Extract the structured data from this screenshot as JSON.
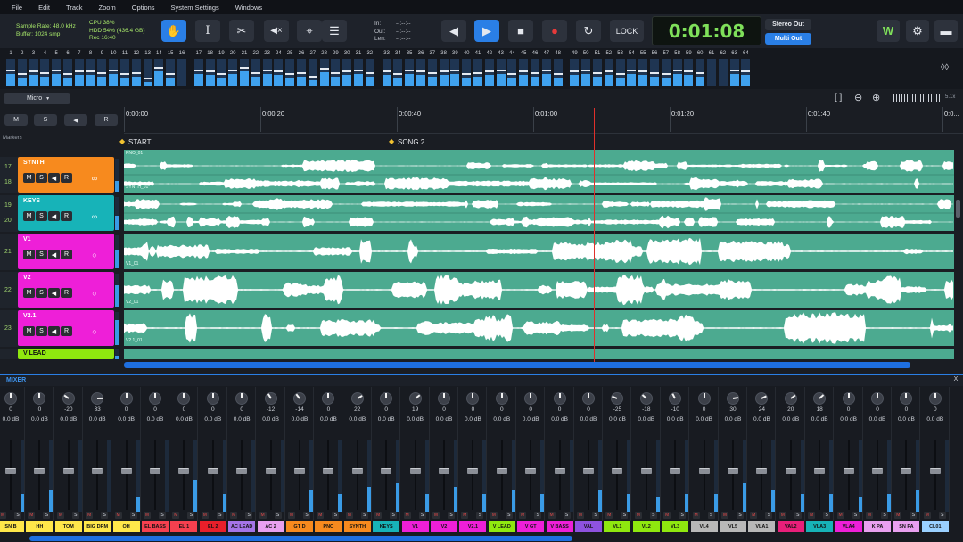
{
  "menu": [
    "File",
    "Edit",
    "Track",
    "Zoom",
    "Options",
    "System Settings",
    "Windows"
  ],
  "status": {
    "sample_rate": "Sample Rate: 48.0 kHz",
    "buffer": "Buffer: 1024 smp",
    "cpu": "CPU 38%",
    "hdd": "HDD 54% (436.4 GB)",
    "rec": "Rec 16:40",
    "in_label": "In:",
    "in_value": "--:--:--",
    "out_label": "Out:",
    "out_value": "--:--:--",
    "len_label": "Len:",
    "len_value": "--:--:--"
  },
  "transport": {
    "lock": "LOCK",
    "time": "0:01:08"
  },
  "outputs": {
    "stereo": "Stereo Out",
    "multi": "Multi Out"
  },
  "meter_channels": [
    "1",
    "2",
    "3",
    "4",
    "5",
    "6",
    "7",
    "8",
    "9",
    "10",
    "11",
    "12",
    "13",
    "14",
    "15",
    "16",
    "17",
    "18",
    "19",
    "20",
    "21",
    "22",
    "23",
    "24",
    "25",
    "26",
    "27",
    "28",
    "29",
    "30",
    "31",
    "32",
    "33",
    "34",
    "35",
    "36",
    "37",
    "38",
    "39",
    "40",
    "41",
    "42",
    "43",
    "44",
    "45",
    "46",
    "47",
    "48",
    "49",
    "50",
    "51",
    "52",
    "53",
    "54",
    "55",
    "56",
    "57",
    "58",
    "59",
    "60",
    "61",
    "62",
    "63",
    "64"
  ],
  "meter_levels": [
    0.45,
    0.3,
    0.4,
    0.35,
    0.45,
    0.3,
    0.4,
    0.4,
    0.35,
    0.45,
    0.3,
    0.35,
    0.15,
    0.55,
    0.3,
    0.0,
    0.45,
    0.4,
    0.3,
    0.45,
    0.55,
    0.35,
    0.45,
    0.4,
    0.3,
    0.35,
    0.2,
    0.5,
    0.35,
    0.4,
    0.45,
    0.35,
    0.4,
    0.3,
    0.45,
    0.4,
    0.35,
    0.4,
    0.45,
    0.3,
    0.35,
    0.4,
    0.45,
    0.3,
    0.4,
    0.35,
    0.45,
    0.3,
    0.4,
    0.45,
    0.35,
    0.4,
    0.3,
    0.45,
    0.4,
    0.35,
    0.3,
    0.45,
    0.4,
    0.35,
    0.0,
    0.0,
    0.45,
    0.4
  ],
  "arrange": {
    "input_select": "Micro",
    "mute_btn": "M",
    "solo_btn": "S",
    "speaker_btn": "◀",
    "rec_btn": "R",
    "zoom_label": "5.1x",
    "markers_label": "Markers",
    "markers": [
      "START",
      "SONG 2"
    ],
    "ruler": [
      "0:00:00",
      "0:00:20",
      "0:00:40",
      "0:01:00",
      "0:01:20",
      "0:01:40",
      "0:0..."
    ]
  },
  "tracks": [
    {
      "nums": [
        "17",
        "18"
      ],
      "name": "SYNTH",
      "color": "#f78a1e",
      "clip": "SYNTH_01",
      "top_clip": "PNO_01",
      "ring": "∞"
    },
    {
      "nums": [
        "19",
        "20"
      ],
      "name": "KEYS",
      "color": "#17b3b8",
      "clip": "",
      "top_clip": "",
      "ring": "∞"
    },
    {
      "nums": [
        "21"
      ],
      "name": "V1",
      "color": "#ee1fd8",
      "clip": "V1_01",
      "top_clip": "",
      "ring": "○"
    },
    {
      "nums": [
        "22"
      ],
      "name": "V2",
      "color": "#ee1fd8",
      "clip": "V2_01",
      "top_clip": "",
      "ring": "○"
    },
    {
      "nums": [
        "23"
      ],
      "name": "V2.1",
      "color": "#ee1fd8",
      "clip": "V2.1_01",
      "top_clip": "",
      "ring": "○"
    },
    {
      "nums": [
        ""
      ],
      "name": "V LEAD",
      "color": "#8fe80f",
      "clip": "",
      "top_clip": "",
      "ring": ""
    }
  ],
  "track_buttons": [
    "M",
    "S",
    "◀",
    "R"
  ],
  "mixer": {
    "title": "MIXER",
    "close": "X",
    "channels": [
      {
        "name": "SN B",
        "color": "#ffe74a",
        "pan": "0",
        "db": "0.0 dB",
        "fader": 0.55,
        "level": 0.25
      },
      {
        "name": "HH",
        "color": "#ffe74a",
        "pan": "0",
        "db": "0.0 dB",
        "fader": 0.55,
        "level": 0.3
      },
      {
        "name": "TOM",
        "color": "#ffe74a",
        "pan": "-20",
        "db": "0.0 dB",
        "fader": 0.55,
        "level": 0.0
      },
      {
        "name": "BIG DRM",
        "color": "#ffe74a",
        "pan": "33",
        "db": "0.0 dB",
        "fader": 0.55,
        "level": 0.0
      },
      {
        "name": "OH",
        "color": "#ffe74a",
        "pan": "0",
        "db": "0.0 dB",
        "fader": 0.55,
        "level": 0.2
      },
      {
        "name": "EL BASS",
        "color": "#f5404f",
        "pan": "0",
        "db": "0.0 dB",
        "fader": 0.55,
        "level": 0.0
      },
      {
        "name": "EL 1",
        "color": "#f5404f",
        "pan": "0",
        "db": "0.0 dB",
        "fader": 0.55,
        "level": 0.45
      },
      {
        "name": "EL 2",
        "color": "#e81f2a",
        "pan": "0",
        "db": "0.0 dB",
        "fader": 0.55,
        "level": 0.25
      },
      {
        "name": "AC LEAD",
        "color": "#a574e8",
        "pan": "0",
        "db": "0.0 dB",
        "fader": 0.55,
        "level": 0.0
      },
      {
        "name": "AC 2",
        "color": "#e9a0f0",
        "pan": "-12",
        "db": "0.0 dB",
        "fader": 0.55,
        "level": 0.0
      },
      {
        "name": "GT D",
        "color": "#f78a1e",
        "pan": "-14",
        "db": "0.0 dB",
        "fader": 0.55,
        "level": 0.3
      },
      {
        "name": "PNO",
        "color": "#f78a1e",
        "pan": "0",
        "db": "0.0 dB",
        "fader": 0.55,
        "level": 0.25
      },
      {
        "name": "SYNTH",
        "color": "#f78a1e",
        "pan": "22",
        "db": "0.0 dB",
        "fader": 0.55,
        "level": 0.35
      },
      {
        "name": "KEYS",
        "color": "#17b3b8",
        "pan": "0",
        "db": "0.0 dB",
        "fader": 0.55,
        "level": 0.4
      },
      {
        "name": "V1",
        "color": "#ee1fd8",
        "pan": "19",
        "db": "0.0 dB",
        "fader": 0.55,
        "level": 0.25
      },
      {
        "name": "V2",
        "color": "#ee1fd8",
        "pan": "0",
        "db": "0.0 dB",
        "fader": 0.55,
        "level": 0.35
      },
      {
        "name": "V2.1",
        "color": "#ee1fd8",
        "pan": "0",
        "db": "0.0 dB",
        "fader": 0.55,
        "level": 0.25
      },
      {
        "name": "V LEAD",
        "color": "#8fe80f",
        "pan": "0",
        "db": "0.0 dB",
        "fader": 0.55,
        "level": 0.3
      },
      {
        "name": "V GT",
        "color": "#ee1fd8",
        "pan": "0",
        "db": "0.0 dB",
        "fader": 0.55,
        "level": 0.25
      },
      {
        "name": "V BASS",
        "color": "#ee1fd8",
        "pan": "0",
        "db": "0.0 dB",
        "fader": 0.55,
        "level": 0.0
      },
      {
        "name": "VAL",
        "color": "#8e52e0",
        "pan": "0",
        "db": "0.0 dB",
        "fader": 0.55,
        "level": 0.3
      },
      {
        "name": "VL1",
        "color": "#8fe80f",
        "pan": "-25",
        "db": "0.0 dB",
        "fader": 0.55,
        "level": 0.25
      },
      {
        "name": "VL2",
        "color": "#8fe80f",
        "pan": "-18",
        "db": "0.0 dB",
        "fader": 0.55,
        "level": 0.2
      },
      {
        "name": "VL3",
        "color": "#8fe80f",
        "pan": "-10",
        "db": "0.0 dB",
        "fader": 0.55,
        "level": 0.25
      },
      {
        "name": "VL4",
        "color": "#b8b8b8",
        "pan": "0",
        "db": "0.0 dB",
        "fader": 0.55,
        "level": 0.25
      },
      {
        "name": "VL5",
        "color": "#b8b8b8",
        "pan": "30",
        "db": "0.0 dB",
        "fader": 0.55,
        "level": 0.4
      },
      {
        "name": "VLA1",
        "color": "#b8b8b8",
        "pan": "24",
        "db": "0.0 dB",
        "fader": 0.55,
        "level": 0.3
      },
      {
        "name": "VAL2",
        "color": "#e81f7a",
        "pan": "20",
        "db": "0.0 dB",
        "fader": 0.55,
        "level": 0.25
      },
      {
        "name": "VLA3",
        "color": "#17b3b8",
        "pan": "18",
        "db": "0.0 dB",
        "fader": 0.55,
        "level": 0.25
      },
      {
        "name": "VLA4",
        "color": "#ee1fd8",
        "pan": "0",
        "db": "0.0 dB",
        "fader": 0.55,
        "level": 0.2
      },
      {
        "name": "K PA",
        "color": "#e9a0f0",
        "pan": "0",
        "db": "0.0 dB",
        "fader": 0.55,
        "level": 0.25
      },
      {
        "name": "SN PA",
        "color": "#e9a0f0",
        "pan": "0",
        "db": "0.0 dB",
        "fader": 0.55,
        "level": 0.3
      },
      {
        "name": "CL01",
        "color": "#9ad0ff",
        "pan": "0",
        "db": "0.0 dB",
        "fader": 0.55,
        "level": 0.0
      }
    ],
    "strip_buttons": [
      "M",
      "S"
    ]
  },
  "colors": {
    "accent": "#2a7fe6",
    "time": "#7fe05a",
    "waveform_bg": "#4caa90",
    "playhead": "#e0302b"
  }
}
